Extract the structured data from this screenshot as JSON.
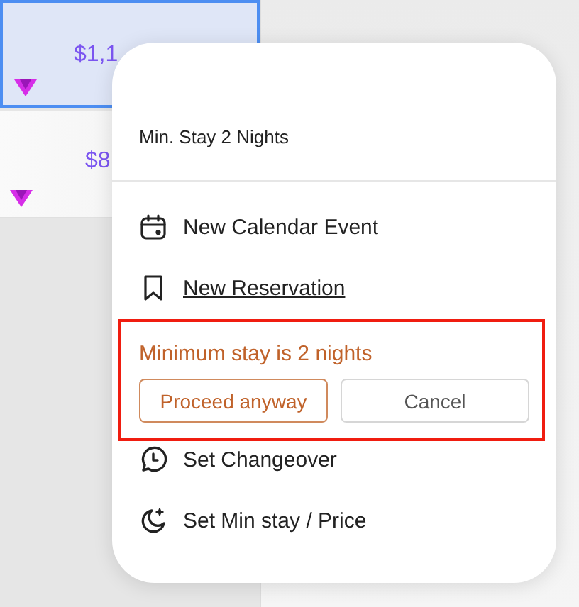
{
  "calendar": {
    "cells": [
      {
        "price": "$1,1",
        "selected": true
      },
      {
        "price": "$8",
        "selected": false
      }
    ]
  },
  "popup": {
    "header": "Min. Stay 2 Nights",
    "items": [
      {
        "kind": "calendar",
        "label": "New Calendar Event",
        "underlined": false
      },
      {
        "kind": "bookmark",
        "label": "New Reservation",
        "underlined": true
      }
    ],
    "alert": {
      "message": "Minimum stay is 2 nights",
      "buttons": [
        {
          "label": "Proceed anyway",
          "kind": "primary"
        },
        {
          "label": "Cancel",
          "kind": "secondary"
        }
      ]
    },
    "items_after": [
      {
        "kind": "changeover",
        "label": "Set Changeover",
        "underlined": false
      },
      {
        "kind": "moon",
        "label": "Set Min stay / Price",
        "underlined": false
      }
    ]
  }
}
